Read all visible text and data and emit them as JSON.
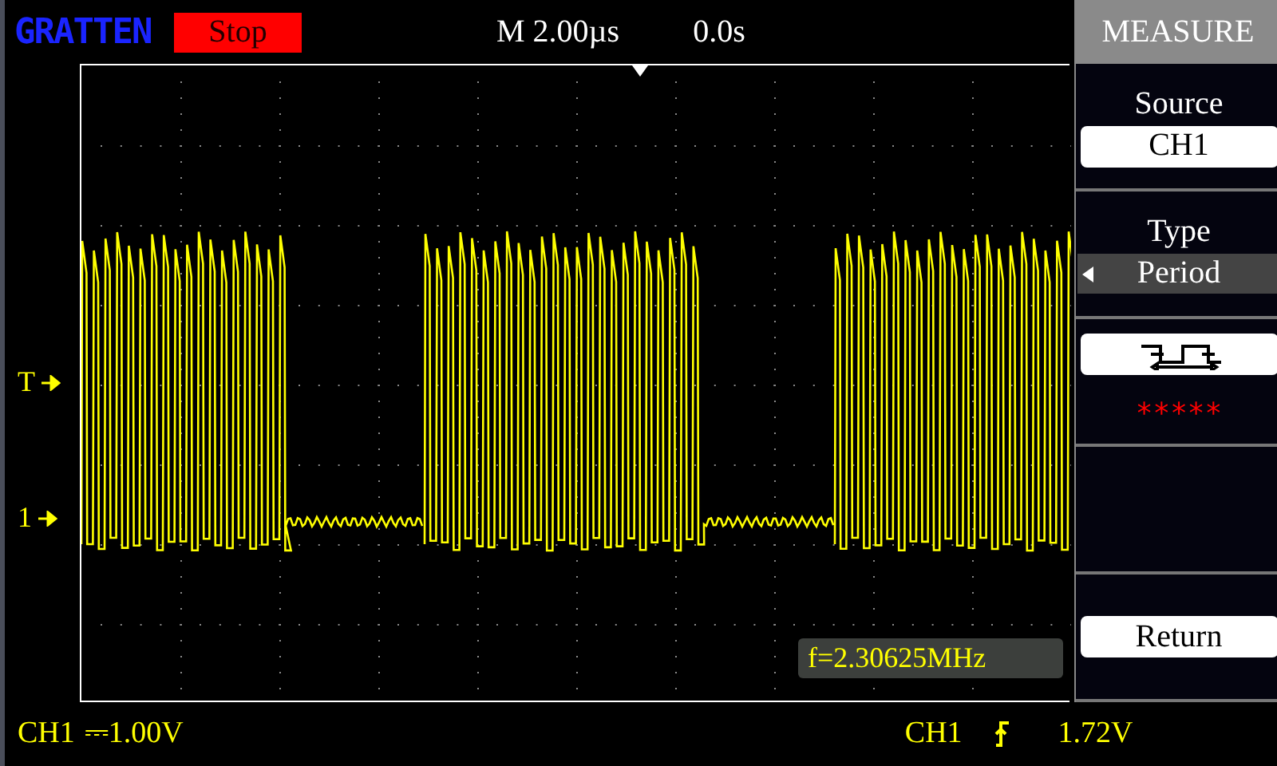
{
  "header": {
    "logo": "GRATTEN",
    "run_state": "Stop",
    "timebase": "M 2.00µs",
    "trigger_position": "0.0s"
  },
  "markers": [
    {
      "label": "T"
    },
    {
      "label": "1"
    }
  ],
  "measurement_overlay": "f=2.30625MHz",
  "menu": {
    "title": "MEASURE",
    "items": [
      {
        "kind": "option",
        "label": "Source",
        "value": "CH1"
      },
      {
        "kind": "selector",
        "label": "Type",
        "value": "Period",
        "selected": true
      },
      {
        "kind": "reading",
        "value": "*****"
      },
      {
        "kind": "empty"
      },
      {
        "kind": "button",
        "label": "Return"
      }
    ]
  },
  "status": {
    "channel": "CH1",
    "coupling": "⎓",
    "scale": "1.00V",
    "trigger_source": "CH1",
    "trigger_level": "1.72V"
  }
}
